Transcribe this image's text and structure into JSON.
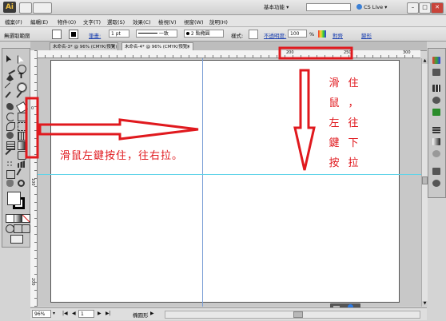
{
  "app": {
    "logo": "Ai"
  },
  "workspace": {
    "label": "基本功能",
    "cs_live": "CS Live"
  },
  "menu": [
    "檔案(F)",
    "編輯(E)",
    "物件(O)",
    "文字(T)",
    "選取(S)",
    "效果(C)",
    "檢視(V)",
    "視窗(W)",
    "說明(H)"
  ],
  "control": {
    "selection": "無選取範圍",
    "stroke_label": "筆畫:",
    "stroke_value": "1 pt",
    "line_style": "一致",
    "brush": "2 點橢圓",
    "style_label": "樣式:",
    "opacity_label": "不透明度:",
    "opacity_value": "100",
    "percent": "%",
    "align_link": "對齊",
    "transform_link": "變形"
  },
  "tabs": [
    {
      "label": "未命名-3* @ 96% (CMYK/預覽)"
    },
    {
      "label": "未命名-4* @ 96% (CMYK/預覽)"
    }
  ],
  "ruler": {
    "h_200": "200",
    "h_250": "250",
    "h_300": "300",
    "v_top": "0",
    "v_mid": "100",
    "v_200": "200"
  },
  "annotations": {
    "left_text": "滑鼠左鍵按住，往右拉。",
    "right_col1": [
      "滑",
      "鼠",
      "左",
      "鍵",
      "按"
    ],
    "right_col2": [
      "住",
      "，",
      "往",
      "下",
      "拉"
    ],
    "color": "#e0191e"
  },
  "status": {
    "zoom": "96%",
    "page": "1",
    "tool": "橢圓形"
  },
  "guide_color": "#5fd3e8",
  "guide_v_color": "#7b9fd6"
}
